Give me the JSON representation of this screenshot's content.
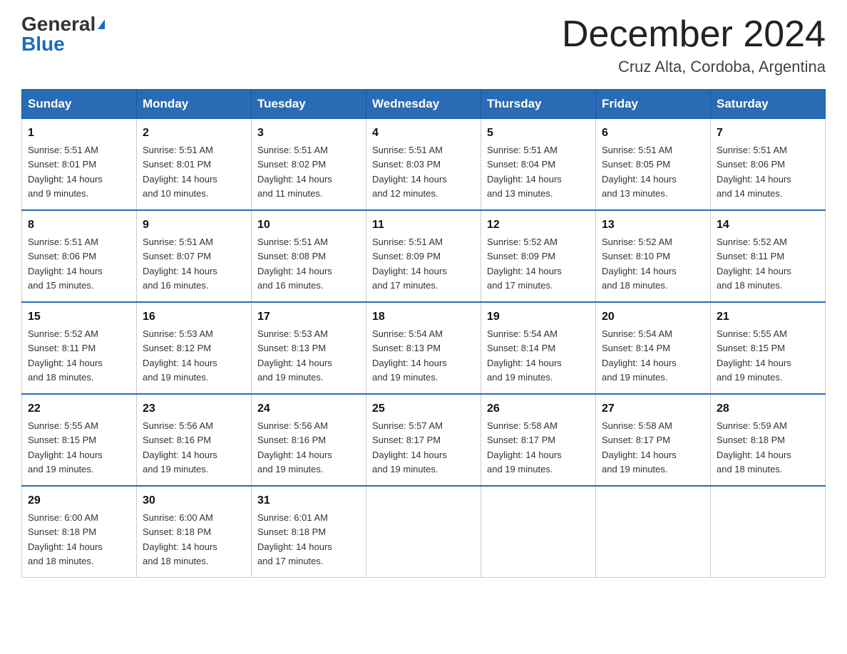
{
  "logo": {
    "general": "General",
    "blue": "Blue"
  },
  "title": "December 2024",
  "location": "Cruz Alta, Cordoba, Argentina",
  "headers": [
    "Sunday",
    "Monday",
    "Tuesday",
    "Wednesday",
    "Thursday",
    "Friday",
    "Saturday"
  ],
  "weeks": [
    [
      {
        "day": "1",
        "sunrise": "5:51 AM",
        "sunset": "8:01 PM",
        "daylight": "14 hours and 9 minutes."
      },
      {
        "day": "2",
        "sunrise": "5:51 AM",
        "sunset": "8:01 PM",
        "daylight": "14 hours and 10 minutes."
      },
      {
        "day": "3",
        "sunrise": "5:51 AM",
        "sunset": "8:02 PM",
        "daylight": "14 hours and 11 minutes."
      },
      {
        "day": "4",
        "sunrise": "5:51 AM",
        "sunset": "8:03 PM",
        "daylight": "14 hours and 12 minutes."
      },
      {
        "day": "5",
        "sunrise": "5:51 AM",
        "sunset": "8:04 PM",
        "daylight": "14 hours and 13 minutes."
      },
      {
        "day": "6",
        "sunrise": "5:51 AM",
        "sunset": "8:05 PM",
        "daylight": "14 hours and 13 minutes."
      },
      {
        "day": "7",
        "sunrise": "5:51 AM",
        "sunset": "8:06 PM",
        "daylight": "14 hours and 14 minutes."
      }
    ],
    [
      {
        "day": "8",
        "sunrise": "5:51 AM",
        "sunset": "8:06 PM",
        "daylight": "14 hours and 15 minutes."
      },
      {
        "day": "9",
        "sunrise": "5:51 AM",
        "sunset": "8:07 PM",
        "daylight": "14 hours and 16 minutes."
      },
      {
        "day": "10",
        "sunrise": "5:51 AM",
        "sunset": "8:08 PM",
        "daylight": "14 hours and 16 minutes."
      },
      {
        "day": "11",
        "sunrise": "5:51 AM",
        "sunset": "8:09 PM",
        "daylight": "14 hours and 17 minutes."
      },
      {
        "day": "12",
        "sunrise": "5:52 AM",
        "sunset": "8:09 PM",
        "daylight": "14 hours and 17 minutes."
      },
      {
        "day": "13",
        "sunrise": "5:52 AM",
        "sunset": "8:10 PM",
        "daylight": "14 hours and 18 minutes."
      },
      {
        "day": "14",
        "sunrise": "5:52 AM",
        "sunset": "8:11 PM",
        "daylight": "14 hours and 18 minutes."
      }
    ],
    [
      {
        "day": "15",
        "sunrise": "5:52 AM",
        "sunset": "8:11 PM",
        "daylight": "14 hours and 18 minutes."
      },
      {
        "day": "16",
        "sunrise": "5:53 AM",
        "sunset": "8:12 PM",
        "daylight": "14 hours and 19 minutes."
      },
      {
        "day": "17",
        "sunrise": "5:53 AM",
        "sunset": "8:13 PM",
        "daylight": "14 hours and 19 minutes."
      },
      {
        "day": "18",
        "sunrise": "5:54 AM",
        "sunset": "8:13 PM",
        "daylight": "14 hours and 19 minutes."
      },
      {
        "day": "19",
        "sunrise": "5:54 AM",
        "sunset": "8:14 PM",
        "daylight": "14 hours and 19 minutes."
      },
      {
        "day": "20",
        "sunrise": "5:54 AM",
        "sunset": "8:14 PM",
        "daylight": "14 hours and 19 minutes."
      },
      {
        "day": "21",
        "sunrise": "5:55 AM",
        "sunset": "8:15 PM",
        "daylight": "14 hours and 19 minutes."
      }
    ],
    [
      {
        "day": "22",
        "sunrise": "5:55 AM",
        "sunset": "8:15 PM",
        "daylight": "14 hours and 19 minutes."
      },
      {
        "day": "23",
        "sunrise": "5:56 AM",
        "sunset": "8:16 PM",
        "daylight": "14 hours and 19 minutes."
      },
      {
        "day": "24",
        "sunrise": "5:56 AM",
        "sunset": "8:16 PM",
        "daylight": "14 hours and 19 minutes."
      },
      {
        "day": "25",
        "sunrise": "5:57 AM",
        "sunset": "8:17 PM",
        "daylight": "14 hours and 19 minutes."
      },
      {
        "day": "26",
        "sunrise": "5:58 AM",
        "sunset": "8:17 PM",
        "daylight": "14 hours and 19 minutes."
      },
      {
        "day": "27",
        "sunrise": "5:58 AM",
        "sunset": "8:17 PM",
        "daylight": "14 hours and 19 minutes."
      },
      {
        "day": "28",
        "sunrise": "5:59 AM",
        "sunset": "8:18 PM",
        "daylight": "14 hours and 18 minutes."
      }
    ],
    [
      {
        "day": "29",
        "sunrise": "6:00 AM",
        "sunset": "8:18 PM",
        "daylight": "14 hours and 18 minutes."
      },
      {
        "day": "30",
        "sunrise": "6:00 AM",
        "sunset": "8:18 PM",
        "daylight": "14 hours and 18 minutes."
      },
      {
        "day": "31",
        "sunrise": "6:01 AM",
        "sunset": "8:18 PM",
        "daylight": "14 hours and 17 minutes."
      },
      null,
      null,
      null,
      null
    ]
  ],
  "labels": {
    "sunrise": "Sunrise:",
    "sunset": "Sunset:",
    "daylight": "Daylight:"
  }
}
